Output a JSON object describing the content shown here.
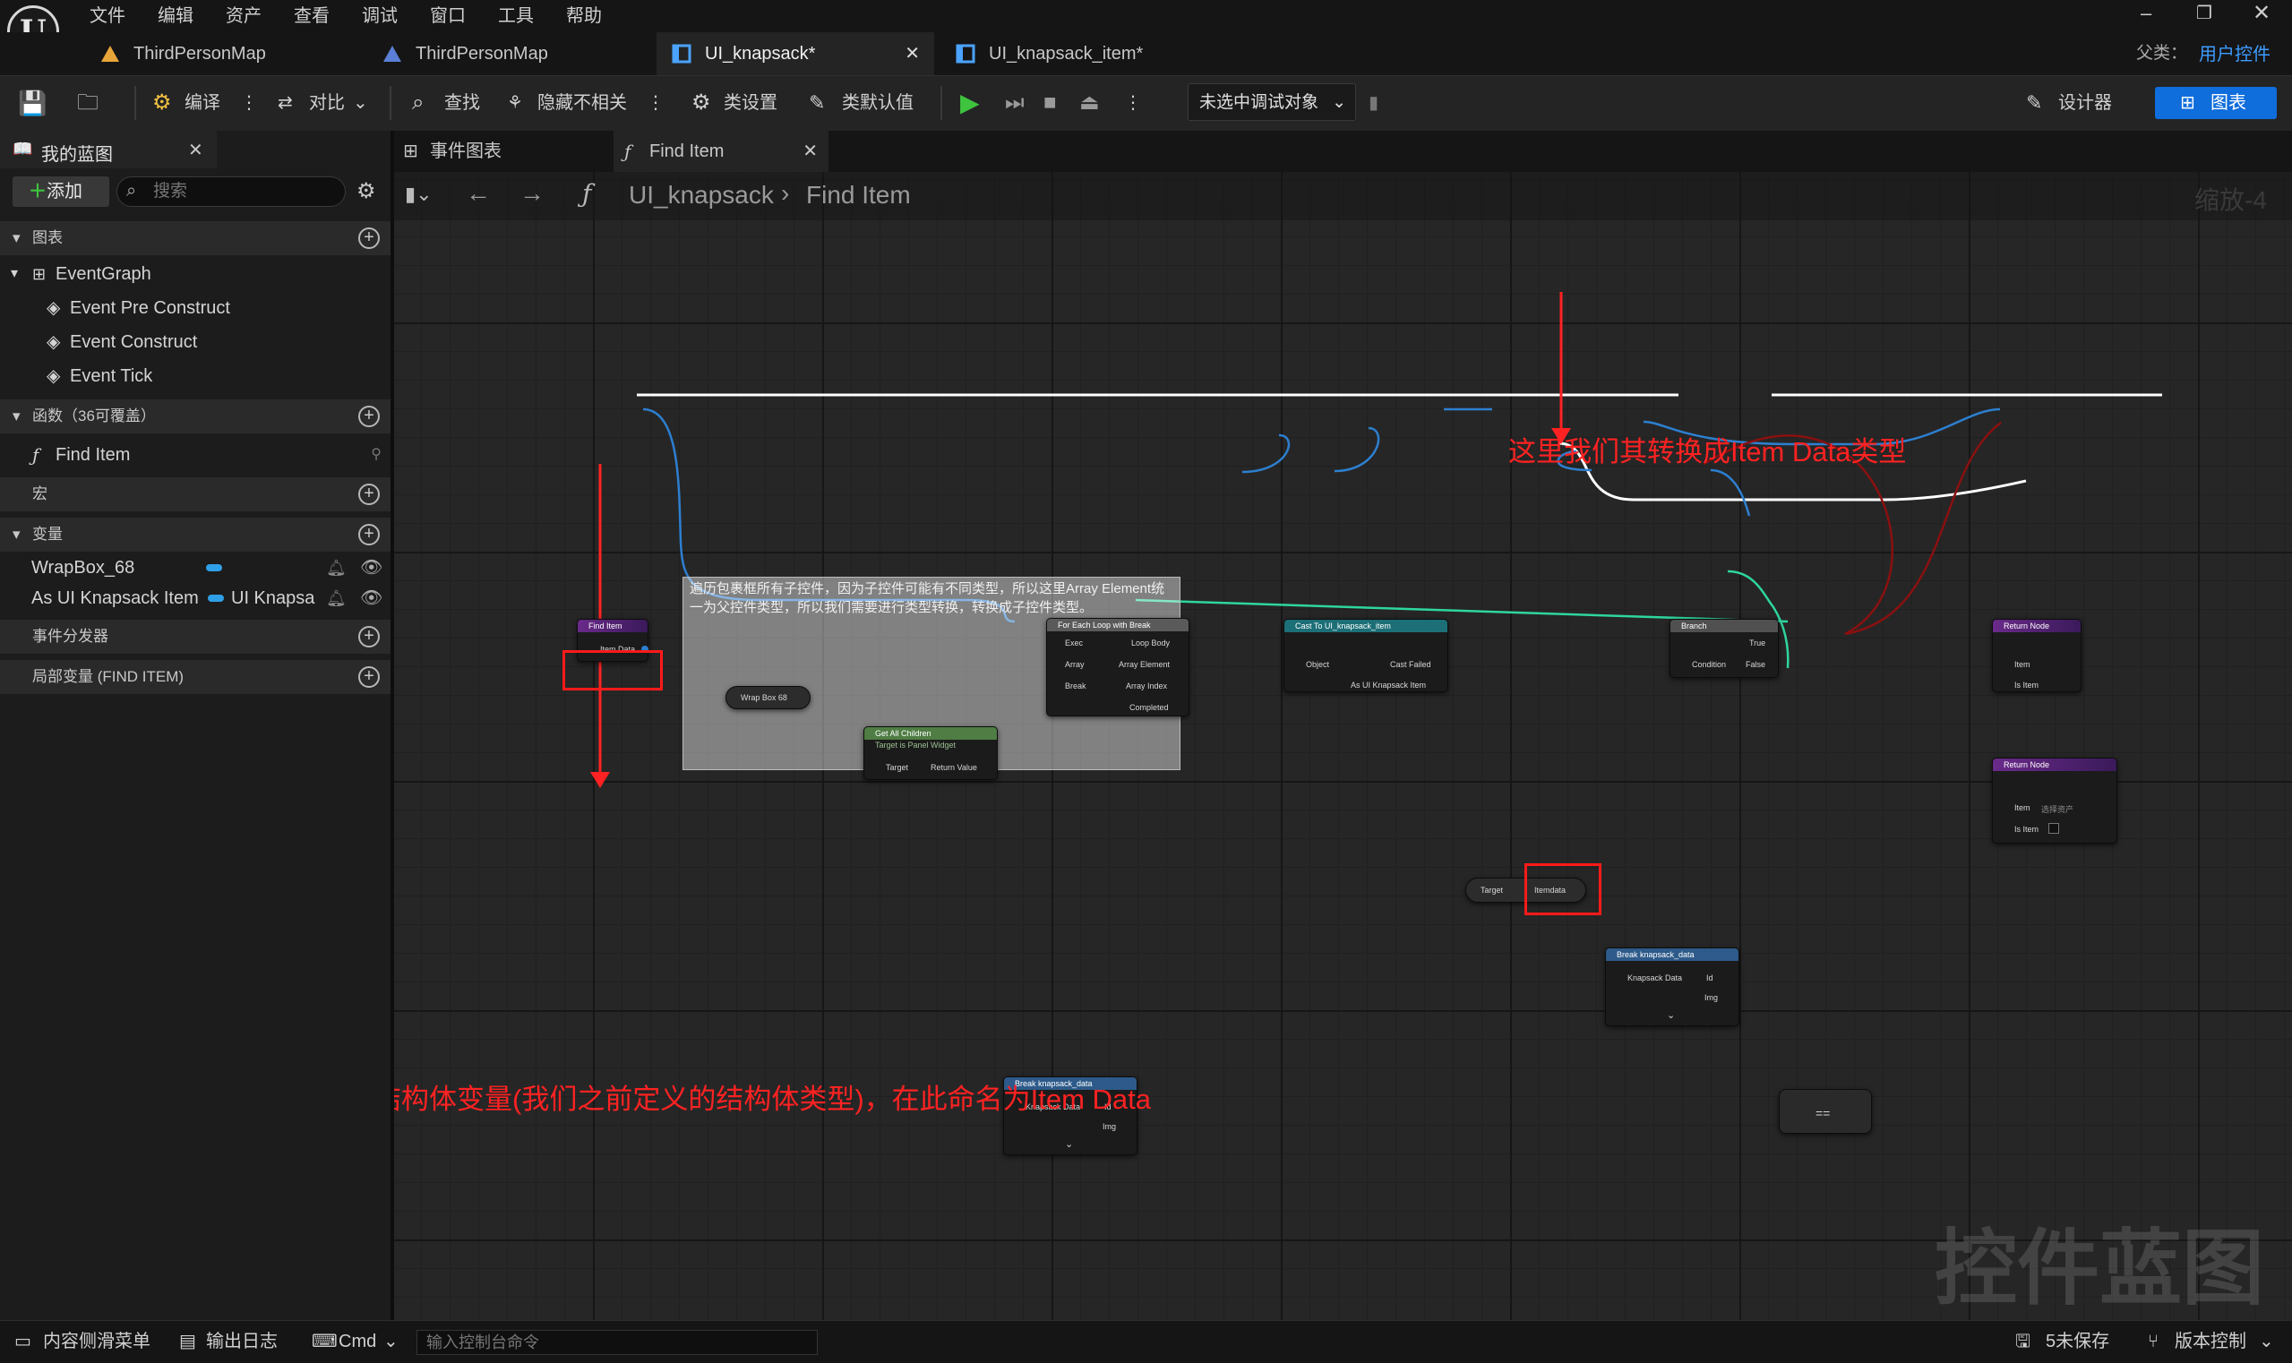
{
  "menu": [
    "文件",
    "编辑",
    "资产",
    "查看",
    "调试",
    "窗口",
    "工具",
    "帮助"
  ],
  "tabs": [
    "ThirdPersonMap",
    "ThirdPersonMap",
    "UI_knapsack*",
    "UI_knapsack_item*"
  ],
  "parent_label": "父类：",
  "parent_value": "用户控件",
  "toolbar": {
    "compile": "编译",
    "diff": "对比",
    "find": "查找",
    "hide": "隐藏不相关",
    "class_settings": "类设置",
    "class_defaults": "类默认值",
    "debug_select": "未选中调试对象",
    "designer": "设计器",
    "graph": "图表"
  },
  "mybp": {
    "title": "我的蓝图",
    "add": "添加",
    "search_placeholder": "搜索"
  },
  "sections": {
    "graphs": "图表",
    "functions": "函数（36可覆盖）",
    "macros": "宏",
    "variables": "变量",
    "dispatchers": "事件分发器",
    "locals": "局部变量 (FIND ITEM)"
  },
  "graph_items": [
    "EventGraph",
    "Event Pre Construct",
    "Event Construct",
    "Event Tick"
  ],
  "function_items": [
    "Find Item"
  ],
  "variables": [
    {
      "name": "WrapBox_68",
      "type": ""
    },
    {
      "name": "As UI Knapsack Item",
      "type": "UI Knapsa"
    }
  ],
  "graph_tabs": {
    "event_graph": "事件图表",
    "find_item": "Find Item"
  },
  "breadcrumb": {
    "blueprint": "UI_knapsack",
    "func": "Find Item",
    "zoom": "缩放-4"
  },
  "nodes": {
    "find_item": {
      "title": "Find Item",
      "pin": "Item Data"
    },
    "wrap_box": {
      "title": "Wrap Box 68"
    },
    "get_children": {
      "title": "Get All Children",
      "sub": "Target is Panel Widget",
      "target": "Target",
      "ret": "Return Value"
    },
    "foreach": {
      "title": "For Each Loop with Break",
      "exec": "Exec",
      "array": "Array",
      "brk": "Break",
      "body": "Loop Body",
      "elem": "Array Element",
      "index": "Array Index",
      "done": "Completed"
    },
    "cast": {
      "title": "Cast To UI_knapsack_item",
      "object": "Object",
      "failed": "Cast Failed",
      "as": "As UI Knapsack Item"
    },
    "branch": {
      "title": "Branch",
      "cond": "Condition",
      "t": "True",
      "f": "False"
    },
    "ret1": {
      "title": "Return Node",
      "item": "Item",
      "isitem": "Is Item"
    },
    "ret2": {
      "title": "Return Node",
      "item": "Item",
      "isitem": "Is Item",
      "select": "选择资产"
    },
    "getter": {
      "target": "Target",
      "var": "Itemdata"
    },
    "break1": {
      "title": "Break knapsack_data",
      "in": "Knapsack Data",
      "id": "Id",
      "img": "Img"
    },
    "break2": {
      "title": "Break knapsack_data",
      "in": "Knapsack Data",
      "id": "Id",
      "img": "Img"
    },
    "equal": {
      "op": "=="
    }
  },
  "comment_text": "遍历包裹框所有子控件，因为子控件可能有不同类型，所以这里Array Element统一为父控件类型，所以我们需要进行类型转换，转换成子控件类型。",
  "annotations": {
    "top": "这里我们其转换成Item Data类型",
    "bottom": "函数输入：结构体变量(我们之前定义的结构体类型)，在此命名为Item Data"
  },
  "watermark": "控件蓝图",
  "status": {
    "drawer": "内容侧滑菜单",
    "log": "输出日志",
    "cmd": "Cmd",
    "console_placeholder": "输入控制台命令",
    "unsaved": "5未保存",
    "vc": "版本控制"
  },
  "colors": {
    "func_header": "#7a2a9a",
    "cast_header": "#1c6f77",
    "struct_pin": "#3b8ee0",
    "object_pin": "#2fa0e8",
    "bool_pin": "#8a1010",
    "int_pin": "#2ed6a0",
    "annotation": "#ff2222",
    "accent": "#0f6ddc"
  }
}
